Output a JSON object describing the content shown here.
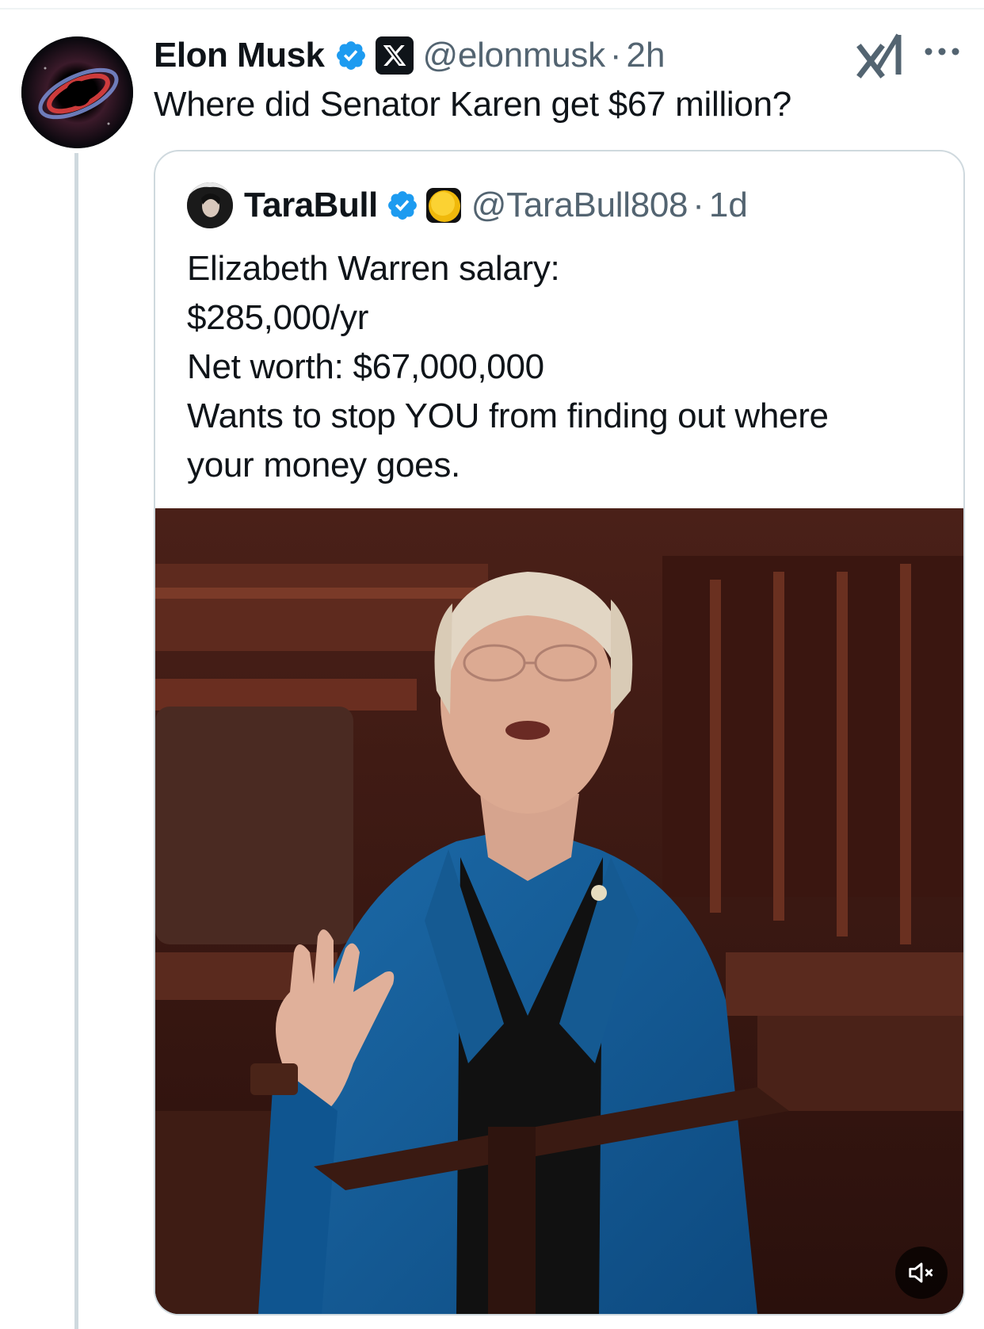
{
  "post": {
    "author_name": "Elon Musk",
    "author_handle": "@elonmusk",
    "separator": "·",
    "time_ago": "2h",
    "text": "Where did Senator Karen get $67 million?"
  },
  "quoted_post": {
    "author_name": "TaraBull",
    "author_handle": "@TaraBull808",
    "separator": "·",
    "time_ago": "1d",
    "lines": [
      "Elizabeth Warren salary:",
      "$285,000/yr",
      "Net worth: $67,000,000",
      "Wants to stop YOU from finding out where",
      "your money goes."
    ]
  },
  "icons": {
    "verified": "verified-badge-icon",
    "affiliate": "x-logo-badge-icon",
    "grok": "grok-icon",
    "more": "more-options-icon",
    "coin": "coin-emoji-icon",
    "mute": "muted-speaker-icon"
  },
  "colors": {
    "verified_blue": "#1d9bf0",
    "secondary_text": "#536471",
    "primary_text": "#0f1419",
    "border": "#cfd9de"
  }
}
